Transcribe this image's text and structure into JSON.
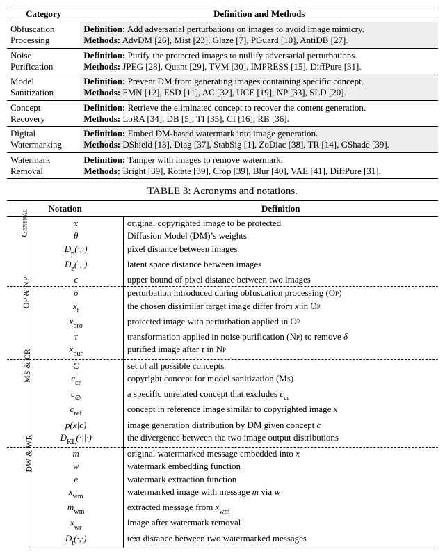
{
  "topTable": {
    "headers": {
      "category": "Category",
      "definition": "Definition and Methods"
    },
    "rows": [
      {
        "gray": true,
        "category": "Obfuscation\nProcessing",
        "definition": "Definition: Add adversarial perturbations on images to avoid image mimicry.",
        "methods": "Methods: AdvDM [26], Mist [23], Glaze [7], PGuard [10], AntiDB [27]."
      },
      {
        "gray": false,
        "category": "Noise\nPurification",
        "definition": "Definition: Purify the protected images to nullify adversarial perturbations.",
        "methods": "Methods: JPEG [28], Quant [29], TVM [30], IMPRESS [15], DiffPure [31]."
      },
      {
        "gray": true,
        "category": "Model\nSanitization",
        "definition": "Definition: Prevent DM from generating images containing specific concept.",
        "methods": "Methods: FMN [12], ESD [11], AC [32], UCE [19], NP [33], SLD [20]."
      },
      {
        "gray": false,
        "category": "Concept\nRecovery",
        "definition": "Definition: Retrieve the eliminated concept to recover the content generation.",
        "methods": "Methods: LoRA [34], DB [5], TI [35], CI [16], RB [36]."
      },
      {
        "gray": true,
        "category": "Digital\nWatermarking",
        "definition": "Definition: Embed DM-based watermark into image generation.",
        "methods": "Methods: DShield [13], Diag [37], StabSig [1], ZoDiac [38], TR [14], GShade [39]."
      },
      {
        "gray": false,
        "category": "Watermark\nRemoval",
        "definition": "Definition: Tamper with images to remove watermark.",
        "methods": "Methods: Bright [39], Rotate [39], Crop [39], Blur [40], VAE [41], DiffPure [31]."
      }
    ]
  },
  "caption": "TABLE 3: Acronyms and notations.",
  "notTable": {
    "headers": {
      "notation": "Notation",
      "definition": "Definition"
    },
    "groups": [
      {
        "label": "General",
        "rows": [
          {
            "n_html": "x",
            "d": "original copyrighted image to be protected"
          },
          {
            "n_html": "θ",
            "d": "Diffusion Model (DM)’s weights"
          },
          {
            "n_html": "D<span class='sub'>p</span>(·,·)",
            "d": "pixel distance between images"
          },
          {
            "n_html": "D<span class='sub'>z</span>(·,·)",
            "d": "latent space distance between images"
          },
          {
            "n_html": "ϵ",
            "d": "upper bound of pixel distance between two images"
          }
        ]
      },
      {
        "label": "OP & NP",
        "rows": [
          {
            "n_html": "δ",
            "d_html": "perturbation introduced during obfuscation processing (<span class='sc'>Op</span>)"
          },
          {
            "n_html": "x<span class='sub'>t</span>",
            "d_html": "the chosen dissimilar target image differ from <i>x</i> in <span class='sc'>Op</span>"
          },
          {
            "n_html": "x<span class='sub'>pro</span>",
            "d_html": "protected image with perturbation applied in <span class='sc'>Op</span>"
          },
          {
            "n_html": "τ",
            "d_html": "transformation applied in noise purification (<span class='sc'>Np</span>) to remove <i>δ</i>"
          },
          {
            "n_html": "x<span class='sub'>pur</span>",
            "d_html": "purified image after <i>τ</i> in <span class='sc'>Np</span>"
          }
        ]
      },
      {
        "label": "MS & CR",
        "rows": [
          {
            "n_html": "C",
            "d": "set of all possible concepts"
          },
          {
            "n_html": "c<span class='sub'>cr</span>",
            "d_html": "copyright concept for model sanitization (<span class='sc'>Ms</span>)"
          },
          {
            "n_html": "c<span class='sub'>∅</span>",
            "d_html": "a specific unrelated concept that excludes <i>c</i><span class='sub'>cr</span>"
          },
          {
            "n_html": "c<span class='sub'>ref</span>",
            "d_html": "concept in reference image similar to copyrighted image <i>x</i>"
          },
          {
            "n_html": "p(x|c)",
            "d_html": "image generation distribution by DM given concept <i>c</i>"
          },
          {
            "n_html": "D<span class='sub'><u>KL</u></span>(·||·)",
            "d": "the divergence between the two image output distributions"
          }
        ]
      },
      {
        "label": "DW & WR",
        "rows": [
          {
            "n_html": "m",
            "d_html": "original watermarked message embedded into <i>x</i>"
          },
          {
            "n_html": "w",
            "d": "watermark embedding function"
          },
          {
            "n_html": "e",
            "d": "watermark extraction function"
          },
          {
            "n_html": "x<span class='sub'>wm</span>",
            "d_html": "watermarked image with message <i>m</i> via <i>w</i>"
          },
          {
            "n_html": "m<span class='sub'>wm</span>",
            "d_html": "extracted message from <i>x</i><span class='sub'>wm</span>"
          },
          {
            "n_html": "x<span class='sub'>wr</span>",
            "d": "image after watermark removal"
          },
          {
            "n_html": "D<span class='sub'>t</span>(·,·)",
            "d": "text distance between two watermarked messages"
          }
        ]
      }
    ]
  }
}
